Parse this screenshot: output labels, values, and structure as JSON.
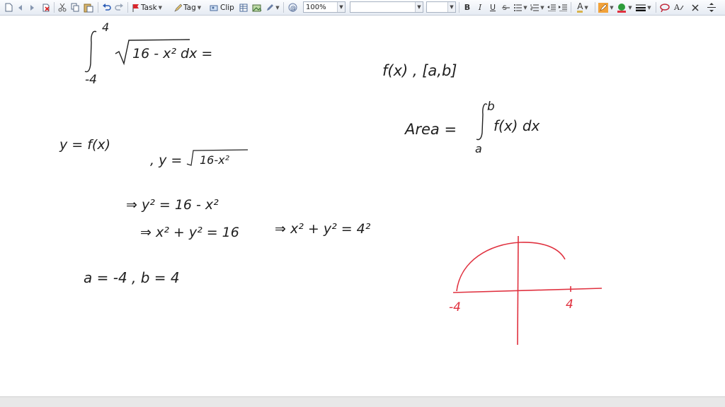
{
  "toolbar": {
    "task_label": "Task",
    "tag_label": "Tag",
    "clip_label": "Clip",
    "zoom_value": "100%",
    "font_value": "",
    "size_value": "",
    "bold_label": "B",
    "italic_label": "I",
    "underline_label": "U",
    "font_color_label": "A",
    "clear_format_label": "A",
    "colors": {
      "highlight": "#f2a23a",
      "pen": "#2c9c3a",
      "ink": "#e0313f"
    }
  },
  "page": {
    "left_notes": {
      "int_upper": "4",
      "int_lower": "-4",
      "int_expr": "16 - x²  dx =",
      "y_eq_fx": "y = f(x)",
      "y_eq_sqrt_prefix": ", y =",
      "y_eq_sqrt_body": "16-x²",
      "line3": "⇒  y² = 16 - x²",
      "line4a": "⇒  x² + y² = 16",
      "line4b": "⇒ x² + y² = 4²",
      "line5": "a = -4  , b = 4"
    },
    "right_notes": {
      "fx_interval": "f(x)    , [a,b]",
      "area_prefix": "Area =",
      "area_upper": "b",
      "area_lower": "a",
      "area_expr": "f(x) dx"
    },
    "graph": {
      "label_left": "-4",
      "label_right": "4"
    }
  }
}
